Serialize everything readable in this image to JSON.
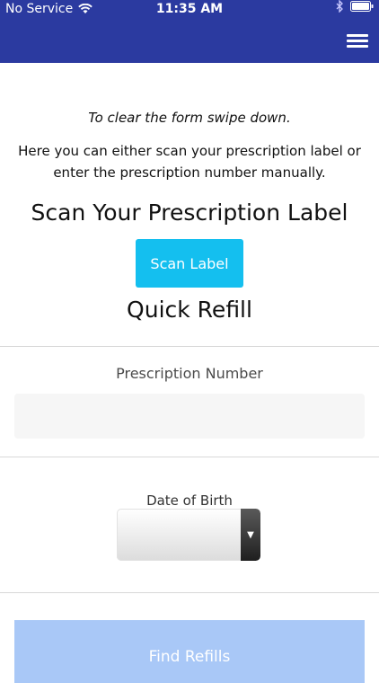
{
  "status_bar": {
    "carrier": "No Service",
    "time": "11:35 AM"
  },
  "header": {
    "menu_icon": "hamburger-menu-icon",
    "background_color": "#2b3aa0"
  },
  "form": {
    "swipe_hint": "To clear the form swipe down.",
    "description": "Here you can either scan your prescription label or enter the prescription number manually.",
    "scan_title": "Scan Your Prescription Label",
    "scan_button_label": "Scan Label",
    "quick_refill_title": "Quick Refill",
    "prescription_number_label": "Prescription Number",
    "prescription_number_value": "",
    "date_of_birth_label": "Date of Birth",
    "date_of_birth_value": "",
    "find_button_label": "Find Refills"
  },
  "colors": {
    "accent": "#14bfef",
    "find_button": "#a9c8f7"
  }
}
